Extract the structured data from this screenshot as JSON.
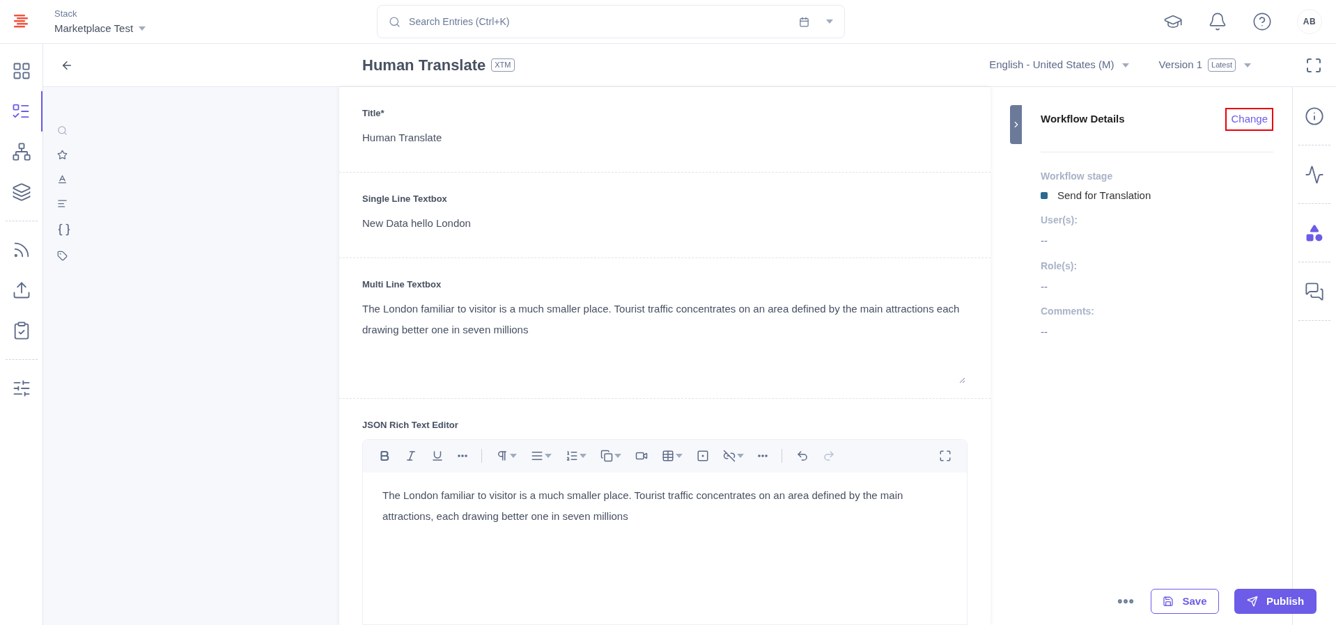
{
  "stack": {
    "label": "Stack",
    "name": "Marketplace Test"
  },
  "search": {
    "placeholder": "Search Entries (Ctrl+K)"
  },
  "user": {
    "initials": "AB"
  },
  "nav": [
    {
      "kind": "dashboard",
      "selected": false
    },
    {
      "kind": "entries",
      "selected": true
    },
    {
      "kind": "content-types",
      "selected": false
    },
    {
      "kind": "assets",
      "selected": false
    },
    {
      "kind": "separator"
    },
    {
      "kind": "releases",
      "selected": false
    },
    {
      "kind": "publish-queue",
      "selected": false
    },
    {
      "kind": "tasks",
      "selected": false
    },
    {
      "kind": "separator"
    },
    {
      "kind": "settings",
      "selected": false
    }
  ],
  "entry": {
    "title": "Human Translate",
    "badge": "XTM",
    "locale": "English - United States (M)",
    "version": "Version 1",
    "version_badge": "Latest"
  },
  "field_tools": [
    {
      "kind": "search"
    },
    {
      "kind": "star"
    },
    {
      "kind": "text"
    },
    {
      "kind": "align"
    },
    {
      "kind": "template"
    },
    {
      "kind": "tag"
    }
  ],
  "fields": [
    {
      "kind": "text",
      "label": "Title*",
      "value": "Human Translate"
    },
    {
      "kind": "text",
      "label": "Single Line Textbox",
      "value": "New Data hello London"
    },
    {
      "kind": "textarea",
      "label": "Multi Line Textbox",
      "value": "The London familiar to visitor is a much smaller place. Tourist traffic concentrates on an area defined by the main attractions each drawing better one in seven millions"
    },
    {
      "kind": "rte",
      "label": "JSON Rich Text Editor",
      "value": "The London familiar to visitor is a much smaller place. Tourist traffic concentrates on an area defined by the main attractions, each drawing better one in seven millions"
    }
  ],
  "toolbar": [
    {
      "kind": "bold"
    },
    {
      "kind": "italic"
    },
    {
      "kind": "underline"
    },
    {
      "kind": "more"
    },
    {
      "kind": "separator"
    },
    {
      "kind": "paragraph"
    },
    {
      "kind": "align"
    },
    {
      "kind": "list"
    },
    {
      "kind": "copy"
    },
    {
      "kind": "video"
    },
    {
      "kind": "table"
    },
    {
      "kind": "embed"
    },
    {
      "kind": "link"
    },
    {
      "kind": "more"
    },
    {
      "kind": "separator"
    },
    {
      "kind": "undo",
      "disabled": false
    },
    {
      "kind": "redo",
      "disabled": true
    },
    {
      "kind": "fullscreen"
    }
  ],
  "workflow": {
    "title": "Workflow Details",
    "change": "Change",
    "stage_label": "Workflow stage",
    "stage": {
      "name": "Send for Translation",
      "color": "#2a6a8e"
    },
    "users_label": "User(s):",
    "users": "--",
    "roles_label": "Role(s):",
    "roles": "--",
    "comments_label": "Comments:",
    "comments": "--"
  },
  "right_rail": [
    {
      "kind": "info",
      "selected": false
    },
    {
      "kind": "activity",
      "selected": false
    },
    {
      "kind": "extensions",
      "selected": true
    },
    {
      "kind": "comments",
      "selected": false
    }
  ],
  "actions": {
    "save": "Save",
    "publish": "Publish"
  }
}
